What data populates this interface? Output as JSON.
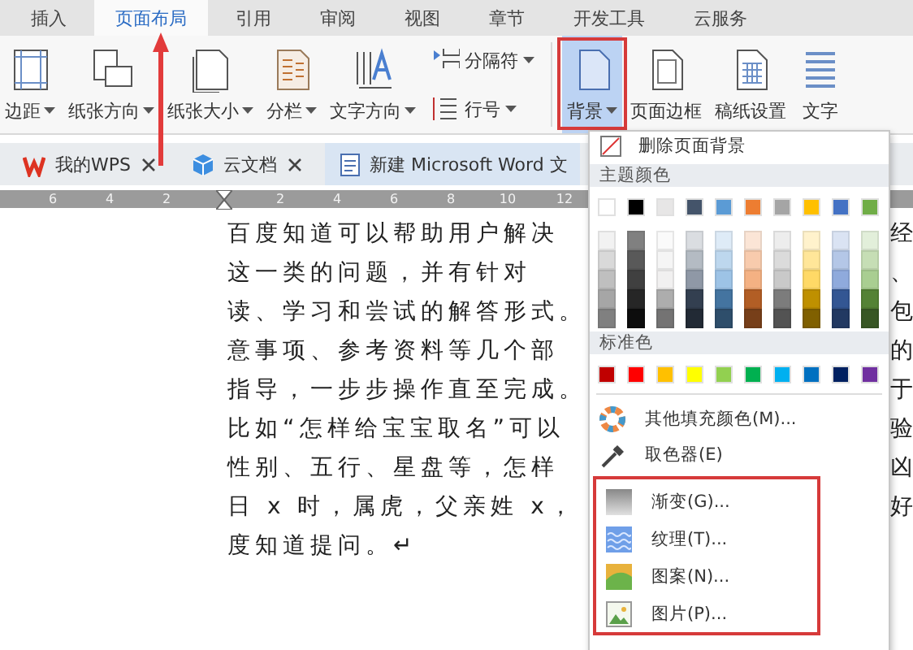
{
  "tabs": [
    {
      "label": "插入",
      "selected": false
    },
    {
      "label": "页面布局",
      "selected": true
    },
    {
      "label": "引用",
      "selected": false
    },
    {
      "label": "审阅",
      "selected": false
    },
    {
      "label": "视图",
      "selected": false
    },
    {
      "label": "章节",
      "selected": false
    },
    {
      "label": "开发工具",
      "selected": false
    },
    {
      "label": "云服务",
      "selected": false
    }
  ],
  "ribbon": [
    {
      "kind": "large",
      "label": "边距",
      "dropdown": true,
      "selected": false
    },
    {
      "kind": "large",
      "label": "纸张方向",
      "dropdown": true,
      "selected": false
    },
    {
      "kind": "large",
      "label": "纸张大小",
      "dropdown": true,
      "selected": false
    },
    {
      "kind": "large",
      "label": "分栏",
      "dropdown": true,
      "selected": false
    },
    {
      "kind": "large",
      "label": "文字方向",
      "dropdown": true,
      "selected": false
    },
    {
      "kind": "pair",
      "items": [
        {
          "label": "分隔符",
          "dropdown": true
        },
        {
          "label": "行号",
          "dropdown": true
        }
      ]
    },
    {
      "kind": "large",
      "label": "背景",
      "dropdown": true,
      "selected": true
    },
    {
      "kind": "large",
      "label": "页面边框",
      "dropdown": false,
      "selected": false
    },
    {
      "kind": "large",
      "label": "稿纸设置",
      "dropdown": false,
      "selected": false
    },
    {
      "kind": "large",
      "label": "文字",
      "dropdown": false,
      "selected": false
    }
  ],
  "doc_tabs": [
    {
      "kind": "wps",
      "label": "我的WPS",
      "selected": false
    },
    {
      "kind": "cloud",
      "label": "云文档",
      "selected": false
    },
    {
      "kind": "doc",
      "label": "新建 Microsoft Word 文",
      "selected": true
    }
  ],
  "ruler": {
    "labels": [
      "6",
      "4",
      "2",
      "2",
      "4",
      "6",
      "8",
      "10",
      "12"
    ]
  },
  "document": {
    "lines": [
      {
        "text": "百度知道可以帮助用户解决",
        "tail": "经"
      },
      {
        "text": "这一类的问题，并有针对",
        "tail": "、"
      },
      {
        "text": "读、学习和尝试的解答形式。",
        "tail": "包"
      },
      {
        "text": "意事项、参考资料等几个部",
        "tail": "的"
      },
      {
        "text": "指导，一步步操作直至完成。",
        "tail": "于"
      },
      {
        "text": "比如“怎样给宝宝取名”可以",
        "tail": "验"
      },
      {
        "text": "性别、五行、星盘等，怎样",
        "tail": "凶"
      },
      {
        "text": "日 x 时，属虎，父亲姓 x，",
        "tail": "好"
      },
      {
        "text": "度知道提问。↵"
      }
    ]
  },
  "menu": {
    "remove": "删除页面背景",
    "theme_header": "主题颜色",
    "theme_colors": [
      {
        "color": "#ffffff"
      },
      {
        "color": "#000000"
      },
      {
        "color": "#e7e6e6"
      },
      {
        "color": "#44546a"
      },
      {
        "color": "#5b9bd5"
      },
      {
        "color": "#ed7d31"
      },
      {
        "color": "#a5a5a5"
      },
      {
        "color": "#ffc000"
      },
      {
        "color": "#4472c4"
      },
      {
        "color": "#70ad47"
      }
    ],
    "standard_header": "标准色",
    "standard_colors": [
      {
        "color": "#c00000"
      },
      {
        "color": "#ff0000"
      },
      {
        "color": "#ffc000"
      },
      {
        "color": "#ffff00"
      },
      {
        "color": "#92d050"
      },
      {
        "color": "#00b050"
      },
      {
        "color": "#00b0f0"
      },
      {
        "color": "#0070c0"
      },
      {
        "color": "#002060"
      },
      {
        "color": "#7030a0"
      }
    ],
    "items": [
      {
        "kind": "more",
        "label": "其他填充颜色(M)..."
      },
      {
        "kind": "picker",
        "label": "取色器(E)"
      }
    ],
    "fill_items": [
      {
        "kind": "gradient",
        "label": "渐变(G)..."
      },
      {
        "kind": "texture",
        "label": "纹理(T)..."
      },
      {
        "kind": "pattern",
        "label": "图案(N)..."
      },
      {
        "kind": "picture",
        "label": "图片(P)..."
      }
    ]
  }
}
